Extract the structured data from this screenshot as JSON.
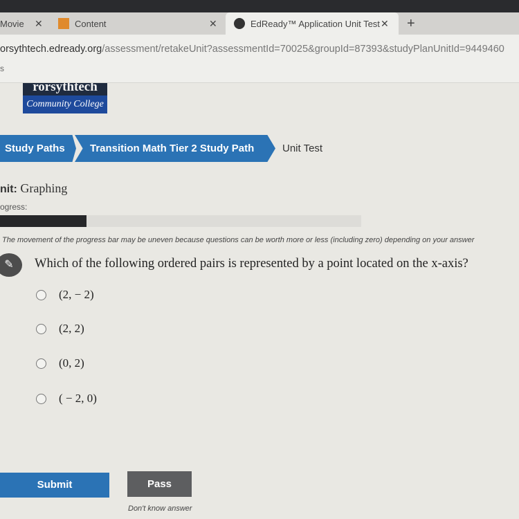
{
  "browser": {
    "tabs": [
      {
        "label": "Movie",
        "icon": "movie-icon"
      },
      {
        "label": "Content",
        "icon": "edit-icon"
      },
      {
        "label": "EdReady™ Application Unit Test",
        "icon": "edready-icon",
        "active": true
      }
    ],
    "url_host": "orsythtech.edready.org",
    "url_path": "/assessment/retakeUnit?assessmentId=70025&groupId=87393&studyPlanUnitId=9449460",
    "bookmarks_fragment": "s"
  },
  "logo": {
    "top": "rorsythtech",
    "bottom": "Community College"
  },
  "breadcrumb": [
    "Study Paths",
    "Transition Math Tier 2 Study Path",
    "Unit Test"
  ],
  "unit": {
    "label": "nit:",
    "value": "Graphing"
  },
  "progress": {
    "label": "ogress:",
    "fraction": 0.24,
    "note": "The movement of the progress bar may be uneven because questions can be worth more or less (including zero) depending on your answer"
  },
  "question": {
    "text": "Which of the following ordered pairs is represented by a point located on the x-axis?",
    "options": [
      "(2, − 2)",
      "(2, 2)",
      "(0, 2)",
      "( − 2, 0)"
    ]
  },
  "buttons": {
    "submit": "Submit",
    "pass": "Pass",
    "dont_know": "Don't know answer"
  },
  "colors": {
    "accent": "#2b73b5",
    "pass": "#5d5e60"
  }
}
